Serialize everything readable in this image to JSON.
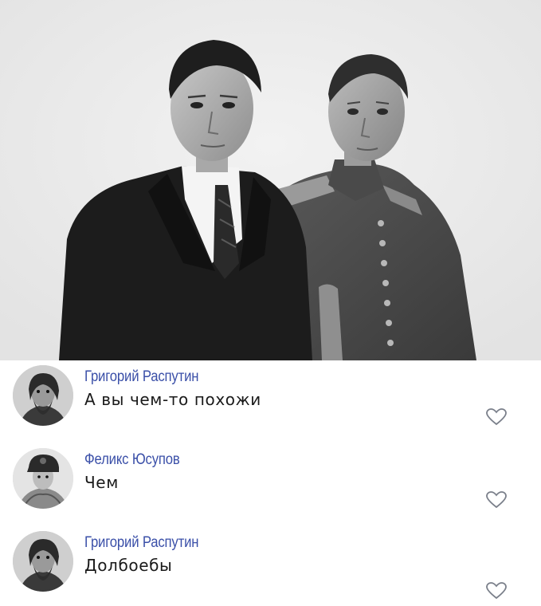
{
  "comments": [
    {
      "author": "Григорий Распутин",
      "text": "А вы чем-то похожи",
      "avatar": "rasputin-portrait",
      "like_icon": "heart-outline-icon"
    },
    {
      "author": "Феликс Юсупов",
      "text": "Чем",
      "avatar": "yusupov-portrait",
      "like_icon": "heart-outline-icon"
    },
    {
      "author": "Григорий Распутин",
      "text": "Долбоебы",
      "avatar": "rasputin-portrait",
      "like_icon": "heart-outline-icon"
    }
  ],
  "colors": {
    "author": "#3a4fa8",
    "text": "#1a1a1a",
    "photo_background": "#ececec",
    "heart_outline": "#7a7f8a"
  }
}
